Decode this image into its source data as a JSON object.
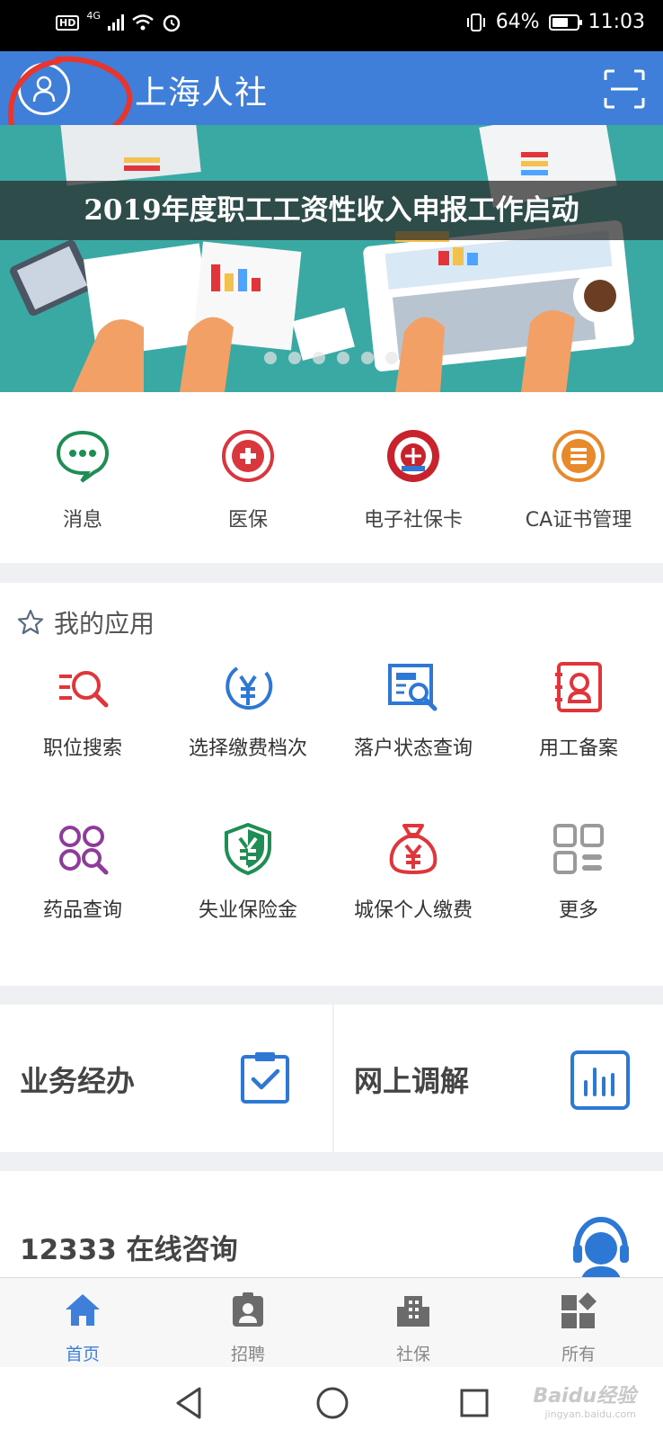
{
  "status_bar": {
    "network": "4G",
    "hd_label": "HD",
    "battery": "64%",
    "battery_level": 0.64,
    "time": "11:03"
  },
  "header": {
    "title": "上海人社",
    "avatar_icon": "user-icon",
    "scan_icon": "scan-icon",
    "annotation_color": "#e8352d"
  },
  "banner": {
    "caption": "2019年度职工工资性收入申报工作启动",
    "slide_count": 6
  },
  "quick_actions": [
    {
      "label": "消息",
      "icon": "chat-icon",
      "color": "#1e8e54"
    },
    {
      "label": "医保",
      "icon": "medical-cross-icon",
      "color": "#d9363e"
    },
    {
      "label": "电子社保卡",
      "icon": "social-security-card-icon",
      "color": "#c8232c"
    },
    {
      "label": "CA证书管理",
      "icon": "list-icon",
      "color": "#e8892b"
    }
  ],
  "my_apps": {
    "title": "我的应用",
    "items": [
      {
        "label": "职位搜索",
        "icon": "job-search-icon",
        "color": "#e0363b"
      },
      {
        "label": "选择缴费档次",
        "icon": "yuan-icon",
        "color": "#2d78d4"
      },
      {
        "label": "落户状态查询",
        "icon": "document-search-icon",
        "color": "#2d78d4"
      },
      {
        "label": "用工备案",
        "icon": "employee-record-icon",
        "color": "#e0363b"
      },
      {
        "label": "药品查询",
        "icon": "medicine-search-icon",
        "color": "#8e3b9c"
      },
      {
        "label": "失业保险金",
        "icon": "shield-yuan-icon",
        "color": "#1e8e54"
      },
      {
        "label": "城保个人缴费",
        "icon": "money-bag-icon",
        "color": "#e0363b"
      },
      {
        "label": "更多",
        "icon": "more-grid-icon",
        "color": "#9a9a9a"
      }
    ]
  },
  "business": [
    {
      "label": "业务经办",
      "icon": "clipboard-check-icon"
    },
    {
      "label": "网上调解",
      "icon": "bar-chart-icon"
    }
  ],
  "consult": {
    "label": "12333 在线咨询",
    "icon": "customer-service-icon"
  },
  "tabbar": [
    {
      "label": "首页",
      "icon": "home-icon",
      "active": true
    },
    {
      "label": "招聘",
      "icon": "id-badge-icon",
      "active": false
    },
    {
      "label": "社保",
      "icon": "building-icon",
      "active": false
    },
    {
      "label": "所有",
      "icon": "all-apps-icon",
      "active": false
    }
  ],
  "colors": {
    "primary": "#3f7fd9",
    "active_tab": "#3f7fd9",
    "inactive_tab": "#888888"
  },
  "watermark": {
    "text": "Baidu经验",
    "sub": "jingyan.baidu.com"
  }
}
